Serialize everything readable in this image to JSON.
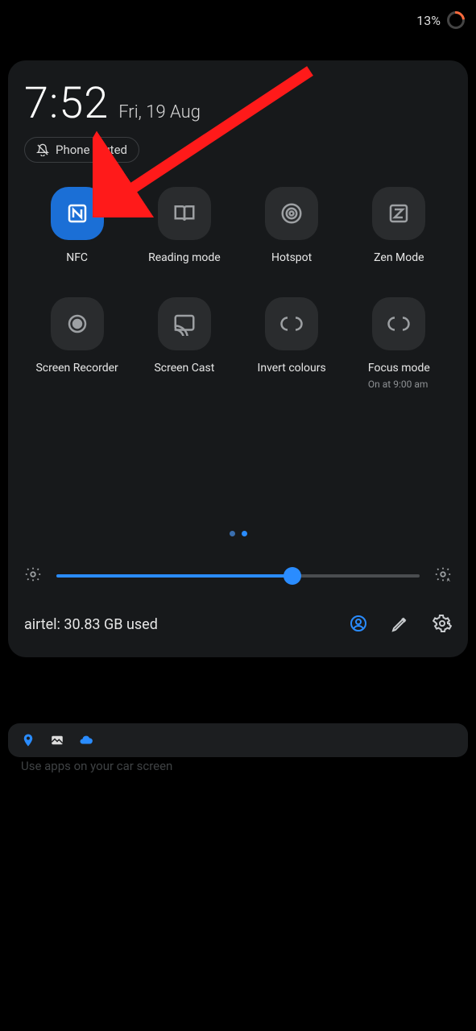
{
  "statusbar": {
    "battery_pct": "13%"
  },
  "clock": {
    "time": "7:52",
    "date": "Fri, 19 Aug"
  },
  "muted_chip": {
    "label": "Phone muted"
  },
  "tiles": [
    {
      "label": "NFC",
      "sublabel": "",
      "active": true
    },
    {
      "label": "Reading mode",
      "sublabel": "",
      "active": false
    },
    {
      "label": "Hotspot",
      "sublabel": "",
      "active": false
    },
    {
      "label": "Zen Mode",
      "sublabel": "",
      "active": false
    },
    {
      "label": "Screen Recorder",
      "sublabel": "",
      "active": false
    },
    {
      "label": "Screen Cast",
      "sublabel": "",
      "active": false
    },
    {
      "label": "Invert colours",
      "sublabel": "",
      "active": false
    },
    {
      "label": "Focus mode",
      "sublabel": "On at 9:00 am",
      "active": false
    }
  ],
  "brightness": {
    "value_pct": 65
  },
  "footer": {
    "data_usage": "airtel: 30.83 GB used"
  },
  "behind_notification": {
    "subtitle": "Use apps on your car screen"
  }
}
